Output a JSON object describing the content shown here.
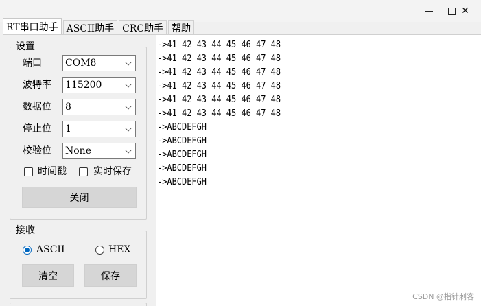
{
  "tabs": [
    {
      "label": "RT串口助手",
      "active": true
    },
    {
      "label": "ASCII助手",
      "active": false
    },
    {
      "label": "CRC助手",
      "active": false
    },
    {
      "label": "帮助",
      "active": false
    }
  ],
  "window_controls": {
    "close_glyph": "✕"
  },
  "settings": {
    "title": "设置",
    "rows": [
      {
        "label": "端口",
        "value": "COM8"
      },
      {
        "label": "波特率",
        "value": "115200"
      },
      {
        "label": "数据位",
        "value": "8"
      },
      {
        "label": "停止位",
        "value": "1"
      },
      {
        "label": "校验位",
        "value": "None"
      }
    ],
    "timestamp_label": "时间戳",
    "timestamp_checked": false,
    "realtime_save_label": "实时保存",
    "realtime_save_checked": false,
    "toggle_button_label": "关闭"
  },
  "receive": {
    "title": "接收",
    "ascii_label": "ASCII",
    "hex_label": "HEX",
    "selected_mode": "ASCII",
    "clear_label": "清空",
    "save_label": "保存"
  },
  "output_lines": [
    "->41 42 43 44 45 46 47 48",
    "->41 42 43 44 45 46 47 48",
    "->41 42 43 44 45 46 47 48",
    "->41 42 43 44 45 46 47 48",
    "->41 42 43 44 45 46 47 48",
    "->41 42 43 44 45 46 47 48",
    "->ABCDEFGH",
    "->ABCDEFGH",
    "->ABCDEFGH",
    "->ABCDEFGH",
    "->ABCDEFGH"
  ],
  "watermark": "CSDN @指针刺客",
  "colors": {
    "radio_accent": "#0067c0"
  }
}
